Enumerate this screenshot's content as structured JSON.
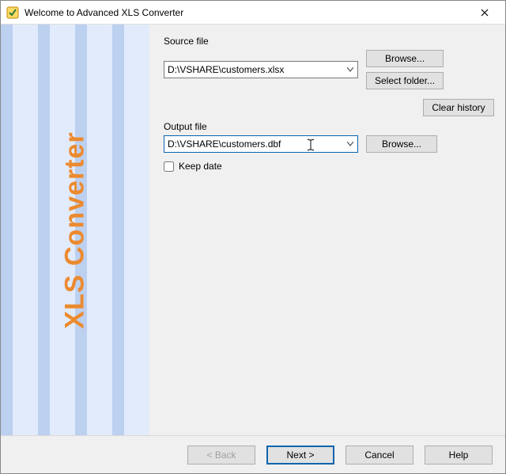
{
  "window": {
    "title": "Welcome to Advanced XLS Converter"
  },
  "sidebar": {
    "brand_text": "XLS Converter"
  },
  "labels": {
    "source_file": "Source file",
    "output_file": "Output file",
    "keep_date": "Keep date"
  },
  "fields": {
    "source_value": "D:\\VSHARE\\customers.xlsx",
    "output_value": "D:\\VSHARE\\customers.dbf"
  },
  "buttons": {
    "browse_source": "Browse...",
    "select_folder": "Select folder...",
    "clear_history": "Clear history",
    "browse_output": "Browse...",
    "back": "< Back",
    "next": "Next >",
    "cancel": "Cancel",
    "help": "Help"
  },
  "state": {
    "keep_date_checked": false
  }
}
